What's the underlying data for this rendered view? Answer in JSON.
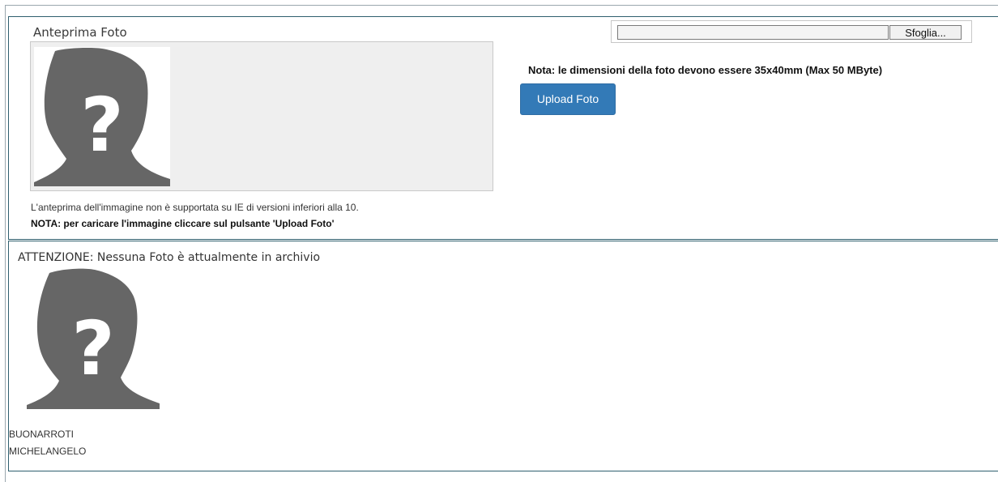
{
  "upload_panel": {
    "preview_title": "Anteprima Foto",
    "placeholder_icon": "unknown-person-question-icon",
    "note_support": "L'anteprima dell'immagine non è supportata su IE di versioni inferiori alla 10.",
    "note_upload": "NOTA: per caricare l'immagine cliccare sul pulsante 'Upload Foto'",
    "file_input_value": "",
    "browse_label": "Sfoglia...",
    "size_note": "Nota: le dimensioni della foto devono essere 35x40mm (Max 50 MByte)",
    "upload_button": "Upload Foto",
    "colors": {
      "button_bg": "#337ab7",
      "panel_border": "#2f5f6e",
      "avatar": "#666666"
    }
  },
  "archive_panel": {
    "attention": "ATTENZIONE: Nessuna Foto è attualmente in archivio",
    "placeholder_icon": "unknown-person-question-icon",
    "surname": "BUONARROTI",
    "firstname": "MICHELANGELO"
  }
}
